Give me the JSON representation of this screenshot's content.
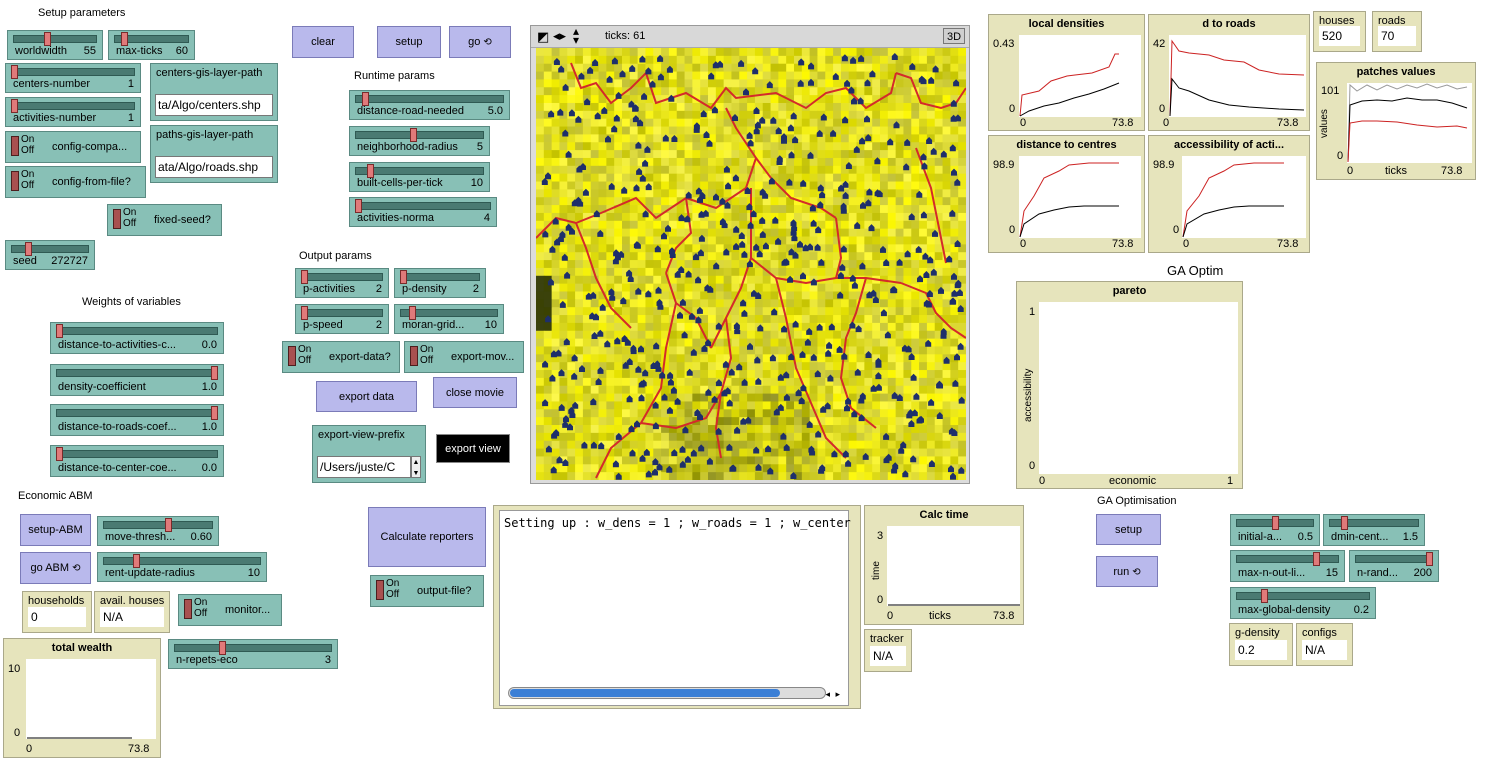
{
  "sections": {
    "setup_parameters": "Setup parameters",
    "weights_of_variables": "Weights of variables",
    "runtime_params": "Runtime params",
    "output_params": "Output params",
    "economic_abm": "Economic ABM",
    "ga_optim": "GA Optim",
    "ga_optimisation": "GA Optimisation"
  },
  "setup_sliders": [
    {
      "name": "worldwidth",
      "value": "55",
      "pos": 0.4
    },
    {
      "name": "max-ticks",
      "value": "60",
      "pos": 0.1
    },
    {
      "name": "centers-number",
      "value": "1",
      "pos": 0.0
    },
    {
      "name": "activities-number",
      "value": "1",
      "pos": 0.0
    }
  ],
  "setup_switches": [
    {
      "name": "config-compa...",
      "on": "On",
      "off": "Off"
    },
    {
      "name": "config-from-file?",
      "on": "On",
      "off": "Off"
    },
    {
      "name": "fixed-seed?",
      "on": "On",
      "off": "Off"
    }
  ],
  "seed_slider": {
    "name": "seed",
    "value": "272727",
    "pos": 0.2
  },
  "centers_input": {
    "name": "centers-gis-layer-path",
    "value": "ta/Algo/centers.shp"
  },
  "paths_input": {
    "name": "paths-gis-layer-path",
    "value": "ata/Algo/roads.shp"
  },
  "weight_sliders": [
    {
      "name": "distance-to-activities-c...",
      "value": "0.0",
      "pos": 0.0
    },
    {
      "name": "density-coefficient",
      "value": "1.0",
      "pos": 1.0
    },
    {
      "name": "distance-to-roads-coef...",
      "value": "1.0",
      "pos": 1.0
    },
    {
      "name": "distance-to-center-coe...",
      "value": "0.0",
      "pos": 0.0
    }
  ],
  "top_buttons": {
    "clear": "clear",
    "setup": "setup",
    "go": "go"
  },
  "runtime_sliders": [
    {
      "name": "distance-road-needed",
      "value": "5.0",
      "pos": 0.05
    },
    {
      "name": "neighborhood-radius",
      "value": "5",
      "pos": 0.45
    },
    {
      "name": "built-cells-per-tick",
      "value": "10",
      "pos": 0.1
    },
    {
      "name": "activities-norma",
      "value": "4",
      "pos": 0.0
    }
  ],
  "output_sliders": [
    {
      "name": "p-activities",
      "value": "2",
      "pos": 0.0
    },
    {
      "name": "p-density",
      "value": "2",
      "pos": 0.0
    },
    {
      "name": "p-speed",
      "value": "2",
      "pos": 0.0
    },
    {
      "name": "moran-grid...",
      "value": "10",
      "pos": 0.1
    }
  ],
  "output_switches": [
    {
      "name": "export-data?",
      "on": "On",
      "off": "Off"
    },
    {
      "name": "export-mov...",
      "on": "On",
      "off": "Off"
    }
  ],
  "export_data_button": "export data",
  "close_movie_button": "close movie",
  "export_prefix_input": {
    "name": "export-view-prefix",
    "value": "/Users/juste/C"
  },
  "export_view_button": "export view",
  "view": {
    "ticks_label": "ticks: 61",
    "btn3d": "3D"
  },
  "plots": {
    "local_densities": {
      "title": "local densities",
      "ymax": "0.43",
      "ymin": "0",
      "xmin": "0",
      "xmax": "73.8"
    },
    "d_to_roads": {
      "title": "d to roads",
      "ymax": "42",
      "ymin": "0",
      "xmin": "0",
      "xmax": "73.8"
    },
    "distance_to_centres": {
      "title": "distance to centres",
      "ymax": "98.9",
      "ymin": "0",
      "xmin": "0",
      "xmax": "73.8"
    },
    "accessibility": {
      "title": "accessibility of acti...",
      "ymax": "98.9",
      "ymin": "0",
      "xmin": "0",
      "xmax": "73.8"
    },
    "patches_values": {
      "title": "patches values",
      "ymax": "101",
      "ymin": "0",
      "xmin": "0",
      "xmax": "73.8",
      "xlabel": "ticks",
      "ylabel": "values"
    },
    "pareto": {
      "title": "pareto",
      "ymax": "1",
      "ymin": "0",
      "xmin": "0",
      "xmax": "1",
      "xlabel": "economic",
      "ylabel": "accessibility"
    },
    "calc_time": {
      "title": "Calc time",
      "ymax": "3",
      "ymin": "0",
      "xmin": "0",
      "xmax": "73.8",
      "xlabel": "ticks",
      "ylabel": "time"
    },
    "total_wealth": {
      "title": "total wealth",
      "ymax": "10",
      "ymin": "0",
      "xmin": "0",
      "xmax": "73.8"
    }
  },
  "monitors_top": [
    {
      "name": "houses",
      "value": "520"
    },
    {
      "name": "roads",
      "value": "70"
    }
  ],
  "calculate_reporters": "Calculate reporters",
  "output_file_switch": {
    "name": "output-file?",
    "on": "On",
    "off": "Off"
  },
  "output_text": "Setting up : w_dens = 1 ; w_roads = 1 ; w_center",
  "tracker_monitor": {
    "name": "tracker",
    "value": "N/A"
  },
  "eco_buttons": {
    "setup": "setup-ABM",
    "go": "go ABM"
  },
  "eco_sliders": [
    {
      "name": "move-thresh...",
      "value": "0.60",
      "pos": 0.6
    },
    {
      "name": "rent-update-radius",
      "value": "10",
      "pos": 0.2
    },
    {
      "name": "n-repets-eco",
      "value": "3",
      "pos": 0.3
    }
  ],
  "eco_monitors": [
    {
      "name": "households",
      "value": "0"
    },
    {
      "name": "avail. houses",
      "value": "N/A"
    }
  ],
  "monitor_switch": {
    "name": "monitor...",
    "on": "On",
    "off": "Off"
  },
  "ga_buttons": {
    "setup": "setup",
    "run": "run"
  },
  "ga_sliders": [
    {
      "name": "initial-a...",
      "value": "0.5",
      "pos": 0.5
    },
    {
      "name": "dmin-cent...",
      "value": "1.5",
      "pos": 0.15
    },
    {
      "name": "max-n-out-li...",
      "value": "15",
      "pos": 0.8
    },
    {
      "name": "n-rand...",
      "value": "200",
      "pos": 1.0
    },
    {
      "name": "max-global-density",
      "value": "0.2",
      "pos": 0.2
    }
  ],
  "ga_monitors": [
    {
      "name": "g-density",
      "value": "0.2"
    },
    {
      "name": "configs",
      "value": "N/A"
    }
  ],
  "colors": {
    "slider": "#88c0b6",
    "button": "#b9b9ec",
    "plot": "#e6e4bc",
    "red": "#cc2222"
  }
}
